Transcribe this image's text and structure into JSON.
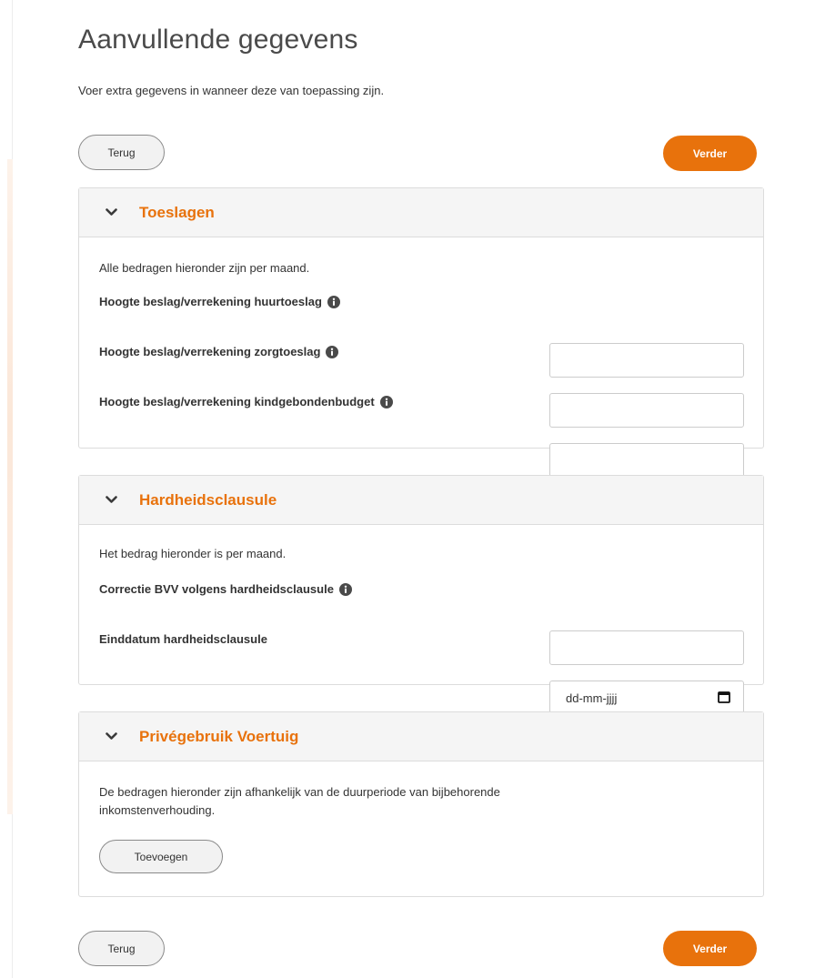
{
  "page": {
    "title": "Aanvullende gegevens",
    "intro": "Voer extra gegevens in wanneer deze van toepassing zijn."
  },
  "nav": {
    "back_label": "Terug",
    "next_label": "Verder"
  },
  "sections": {
    "toeslagen": {
      "title": "Toeslagen",
      "note": "Alle bedragen hieronder zijn per maand.",
      "fields": [
        {
          "label": "Hoogte beslag/verrekening huurtoeslag",
          "value": ""
        },
        {
          "label": "Hoogte beslag/verrekening zorgtoeslag",
          "value": ""
        },
        {
          "label": "Hoogte beslag/verrekening kindgebondenbudget",
          "value": ""
        }
      ]
    },
    "hardheidsclausule": {
      "title": "Hardheidsclausule",
      "note": "Het bedrag hieronder is per maand.",
      "fields": [
        {
          "label": "Correctie BVV volgens hardheidsclausule",
          "value": ""
        },
        {
          "label": "Einddatum hardheidsclausule",
          "placeholder": "dd-mm-jjjj"
        }
      ]
    },
    "voertuig": {
      "title": "Privégebruik Voertuig",
      "note_line1": "De bedragen hieronder zijn afhankelijk van de duurperiode van bijbehorende",
      "note_line2": "inkomstenverhouding.",
      "add_label": "Toevoegen"
    }
  },
  "colors": {
    "accent": "#e8720c",
    "panel_header": "#f5f5f5",
    "border": "#dcdcdc"
  },
  "icons": {
    "section_toggle": "chevron-down-icon",
    "field_help": "info-icon",
    "date_picker": "calendar-icon"
  }
}
